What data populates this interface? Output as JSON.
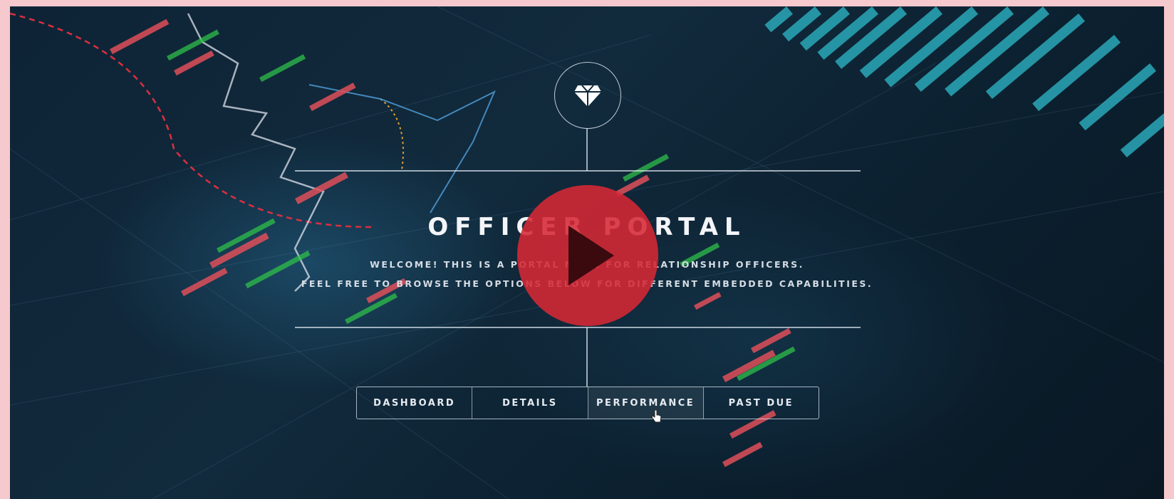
{
  "portal": {
    "title": "OFFICER PORTAL",
    "welcome_line1": "WELCOME! THIS IS A PORTAL MADE FOR RELATIONSHIP OFFICERS.",
    "welcome_line2": "FEEL FREE TO BROWSE THE OPTIONS BELOW FOR DIFFERENT EMBEDDED CAPABILITIES."
  },
  "nav": {
    "items": [
      {
        "label": "DASHBOARD"
      },
      {
        "label": "DETAILS"
      },
      {
        "label": "PERFORMANCE"
      },
      {
        "label": "PAST DUE"
      }
    ],
    "hovered": "PERFORMANCE"
  },
  "icons": {
    "logo": "diamond-icon",
    "play": "play-icon",
    "cursor": "hand-pointer-icon"
  },
  "colors": {
    "page_border": "#f6c9ce",
    "background": "#0e2436",
    "play_button": "#d62834",
    "candle_up": "#2fbf4a",
    "candle_down": "#e0505a",
    "accent_cyan": "#2aa8b8"
  }
}
